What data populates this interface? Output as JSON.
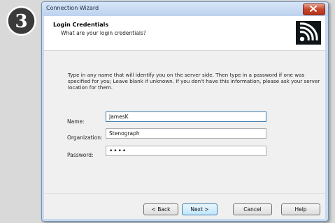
{
  "step_number": "3",
  "window": {
    "title": "Connection Wizard"
  },
  "header": {
    "title": "Login Credentials",
    "subtitle": "What are your login credentials?",
    "logo_icon": "signal-waves-icon"
  },
  "intro_text": "Type in any name that will identify you on the server side. Then type in a password if one was specified for you; Leave blank if unknown. If you don't have this information, please ask your server location for them.",
  "form": {
    "name_label": "Name:",
    "name_value": "JamesK",
    "organization_label": "Organization:",
    "organization_value": "Stenograph",
    "password_label": "Password:",
    "password_value": "••••"
  },
  "buttons": {
    "back": "< Back",
    "next": "Next >",
    "cancel": "Cancel",
    "help": "Help"
  },
  "colors": {
    "titlebar": "#c4d8f0",
    "close_button": "#c6452a",
    "header_logo": "#0f1419"
  }
}
